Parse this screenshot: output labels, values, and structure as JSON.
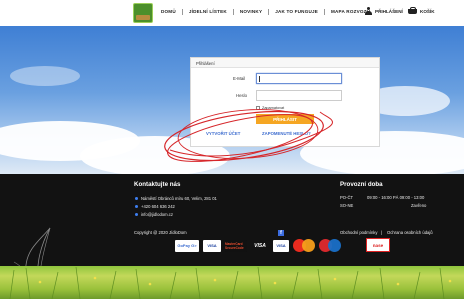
{
  "header": {
    "nav": [
      "DOMŮ",
      "JÍDELNÍ LÍSTEK",
      "NOVINKY",
      "JAK TO FUNGUJE",
      "MAPA ROZVOZU"
    ],
    "login_label": "PŘIHLÁŠENÍ",
    "cart_label": "KOŠÍK"
  },
  "login_form": {
    "heading": "Přihlášení",
    "email_label": "E-Mail",
    "password_label": "Heslo",
    "remember_label": "Zapamatovat",
    "submit_label": "PŘIHLÁSIT",
    "create_account_label": "VYTVOŘIT ÚČET",
    "forgot_password_label": "ZAPOMENUTÉ HESLO?"
  },
  "footer": {
    "contact_title": "Kontaktujte nás",
    "address": "Náměstí Obránců míru 60, Velim, 281 01",
    "phone": "+420 604 636 242",
    "email": "info@jidlodom.cz",
    "hours_title": "Provozní doba",
    "hours": [
      {
        "days": "PO-ČT",
        "time": "09:00 - 16:00 PÁ 09:00 - 13:00"
      },
      {
        "days": "SO-NE",
        "time": "Zavřeno"
      }
    ],
    "copyright": "Copyright @ 2020 JídloDom",
    "terms": "Obchodní podmínky",
    "separator": "|",
    "privacy": "Ochrana osobních údajů",
    "payments": [
      "GoPay G>",
      "VISA",
      "MasterCard SecureCode",
      "VISA",
      "VISA",
      "nase"
    ],
    "facebook": "f"
  },
  "colors": {
    "accent": "#f5a623",
    "link": "#3f6ecf",
    "frame": "#1fce3c",
    "footer_bg": "#121212"
  }
}
